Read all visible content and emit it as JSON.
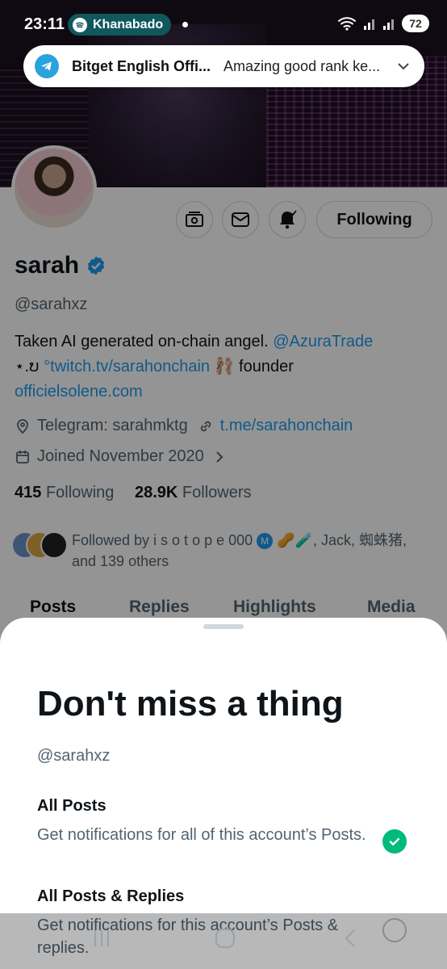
{
  "status_bar": {
    "time": "23:11",
    "media_app": "Khanabadosh",
    "battery": "72"
  },
  "heads_up": {
    "app_icon": "telegram-icon",
    "title": "Bitget English Offi...",
    "message": "Amazing good rank ke..."
  },
  "profile": {
    "display_name": "sarah",
    "handle": "@sarahxz",
    "following_label": "Following",
    "bio": {
      "line1_text": "Taken AI generated on-chain angel. ",
      "line1_mention": "@AzuraTrade",
      "line2_prefix": "⋆.ບ ",
      "line2_link": "°twitch.tv/sarahonchain",
      "line2_emoji": "🩰",
      "line2_suffix": " founder",
      "line3_link": "officielsolene.com"
    },
    "location": "Telegram: sarahmktg",
    "website": "t.me/sarahonchain",
    "joined": "Joined November 2020",
    "following_count": "415",
    "following_word": "Following",
    "followers_count": "28.9K",
    "followers_word": "Followers",
    "followed_by_1": "Followed by i s o t o p e 000 ",
    "followed_by_m": "M",
    "followed_by_emoji": " 🥜🧪",
    "followed_by_2": ", Jack, 蜘蛛猪,",
    "followed_by_3": "and 139 others",
    "tabs": [
      "Posts",
      "Replies",
      "Highlights",
      "Media"
    ]
  },
  "sheet": {
    "title": "Don't miss a thing",
    "handle": "@sarahxz",
    "options": [
      {
        "title": "All Posts",
        "description": "Get notifications for all of this account’s Posts.",
        "selected": true
      },
      {
        "title": "All Posts & Replies",
        "description": "Get notifications for this account’s Posts & replies.",
        "selected": false
      }
    ]
  },
  "colors": {
    "accent": "#1d9bf0",
    "selected_green": "#00ba7c",
    "text_primary": "#0f1419",
    "text_secondary": "#536471"
  }
}
